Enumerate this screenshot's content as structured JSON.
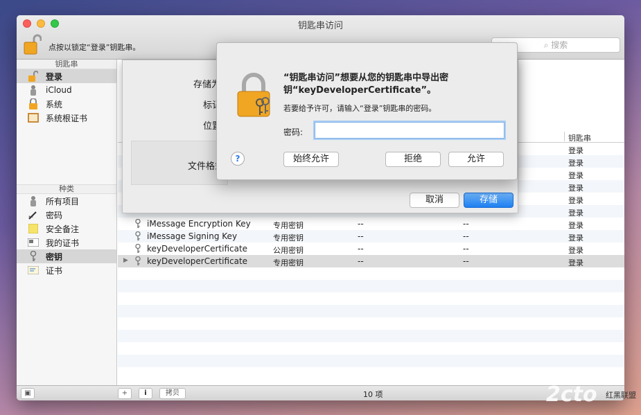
{
  "window": {
    "title": "钥匙串访问"
  },
  "toolbar": {
    "lock_hint": "点按以锁定“登录”钥匙串。",
    "search_placeholder": "搜索"
  },
  "sidebar": {
    "keychains_header": "钥匙串",
    "keychains": [
      {
        "label": "登录",
        "icon": "lock-open-icon",
        "selected": true
      },
      {
        "label": "iCloud",
        "icon": "user-cloud-icon"
      },
      {
        "label": "系统",
        "icon": "lock-icon"
      },
      {
        "label": "系统根证书",
        "icon": "certificate-cabinet-icon"
      }
    ],
    "category_header": "种类",
    "categories": [
      {
        "label": "所有项目",
        "icon": "people-icon"
      },
      {
        "label": "密码",
        "icon": "password-pen-icon"
      },
      {
        "label": "安全备注",
        "icon": "note-icon"
      },
      {
        "label": "我的证书",
        "icon": "my-certificate-icon"
      },
      {
        "label": "密钥",
        "icon": "key-icon",
        "selected": true
      },
      {
        "label": "证书",
        "icon": "certificate-icon"
      }
    ]
  },
  "list": {
    "column_keychain": "钥匙串",
    "rows": [
      {
        "name": "",
        "kind": "",
        "d1": "",
        "d2": "",
        "keychain": "登录"
      },
      {
        "name": "",
        "kind": "",
        "d1": "",
        "d2": "",
        "keychain": "登录"
      },
      {
        "name": "",
        "kind": "",
        "d1": "",
        "d2": "",
        "keychain": "登录"
      },
      {
        "name": "",
        "kind": "",
        "d1": "",
        "d2": "",
        "keychain": "登录"
      },
      {
        "name": "",
        "kind": "",
        "d1": "",
        "d2": "",
        "keychain": "登录"
      },
      {
        "name": "",
        "kind": "",
        "d1": "",
        "d2": "",
        "keychain": "登录"
      },
      {
        "name": "iMessage Encryption Key",
        "kind": "专用密钥",
        "d1": "--",
        "d2": "--",
        "keychain": "登录"
      },
      {
        "name": "iMessage Signing Key",
        "kind": "专用密钥",
        "d1": "--",
        "d2": "--",
        "keychain": "登录"
      },
      {
        "name": "keyDeveloperCertificate",
        "kind": "公用密钥",
        "d1": "--",
        "d2": "--",
        "keychain": "登录"
      },
      {
        "name": "keyDeveloperCertificate",
        "kind": "专用密钥",
        "d1": "--",
        "d2": "--",
        "keychain": "登录",
        "selected": true
      }
    ]
  },
  "bottombar": {
    "add": "+",
    "info": "i",
    "copy": "拷贝",
    "count": "10 项"
  },
  "save_sheet": {
    "save_as_label": "存储为",
    "tags_label": "标记",
    "where_label": "位置",
    "format_label": "文件格式",
    "cancel": "取消",
    "save": "存储"
  },
  "auth_dialog": {
    "title": "“钥匙串访问”想要从您的钥匙串中导出密钥“keyDeveloperCertificate”。",
    "message": "若要给予许可，请输入“登录”钥匙串的密码。",
    "password_label": "密码:",
    "password_value": "",
    "help": "?",
    "always_allow": "始终允许",
    "deny": "拒绝",
    "allow": "允许"
  },
  "watermark": {
    "logo": "2cto",
    "site": "红黑联盟"
  },
  "colors": {
    "accent": "#1e7ff0",
    "lock_gold": "#f0a623"
  }
}
